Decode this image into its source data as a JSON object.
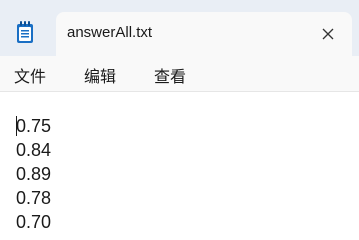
{
  "window": {
    "tab_title": "answerAll.txt",
    "app_icon": "notepad-icon",
    "close_icon": "close-icon"
  },
  "menu": {
    "file": "文件",
    "edit": "编辑",
    "view": "查看"
  },
  "editor": {
    "lines": [
      "0.75",
      "0.84",
      "0.89",
      "0.78",
      "0.70"
    ]
  },
  "colors": {
    "tabstrip_bg": "#e9eef5",
    "active_tab_bg": "#f9f9f9",
    "icon_accent": "#1a6fc4"
  }
}
